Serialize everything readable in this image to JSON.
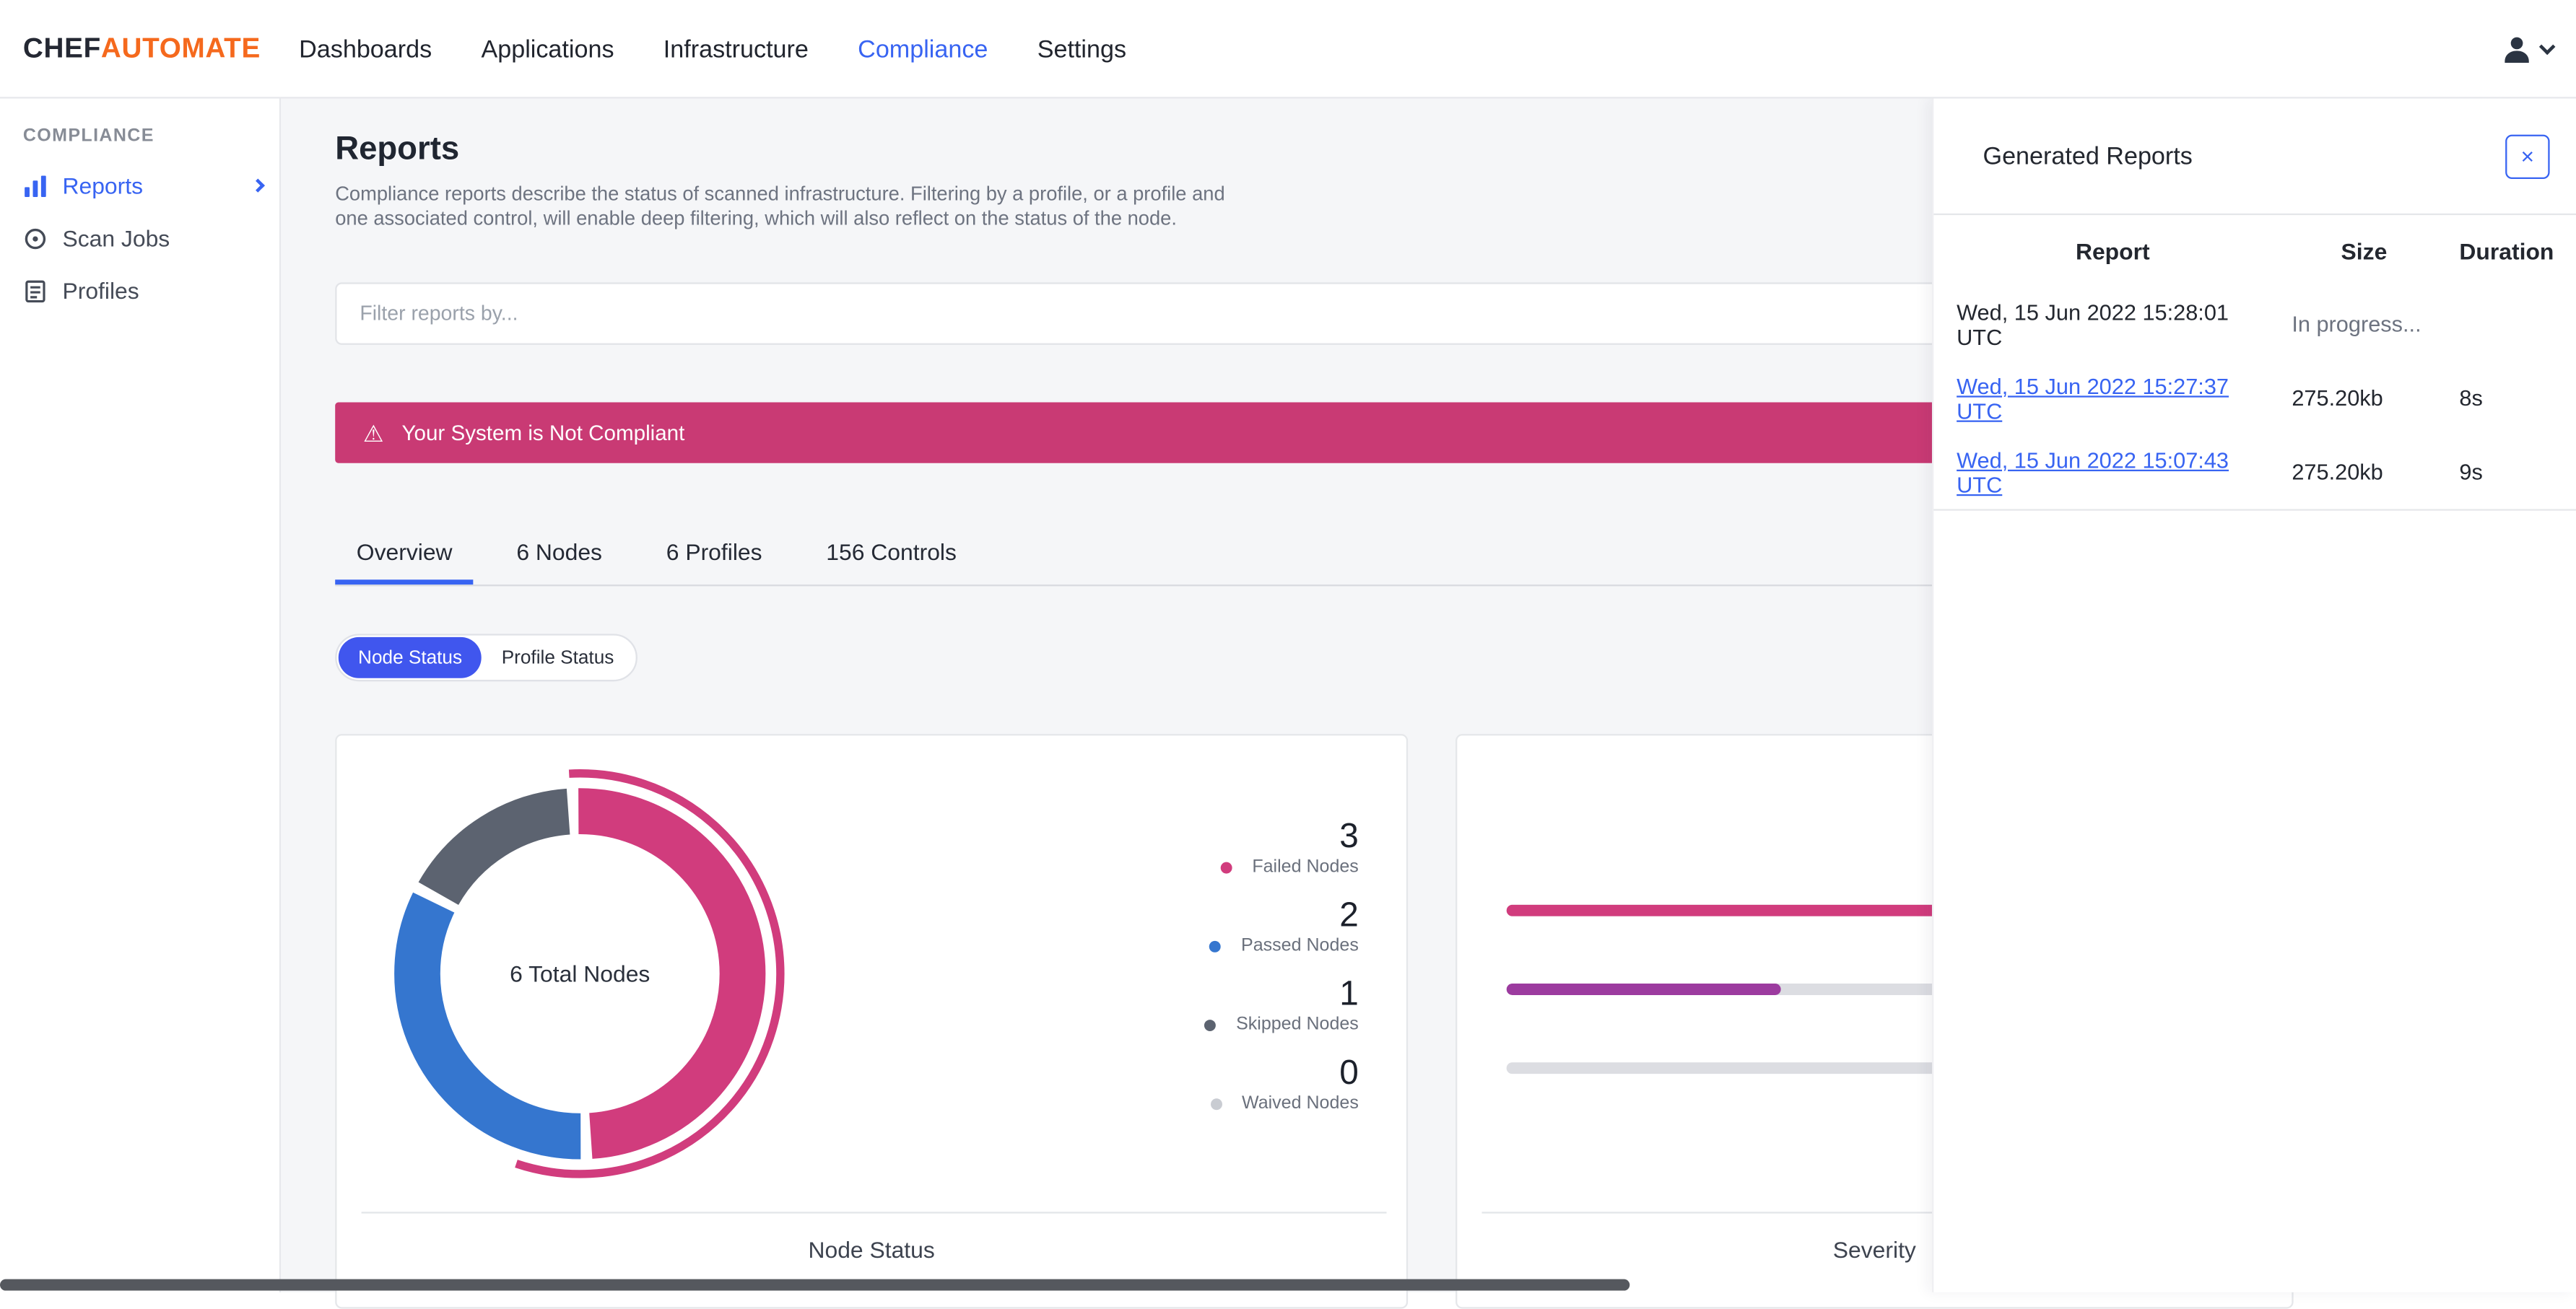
{
  "navbar": {
    "logo_chef": "CHEF",
    "logo_automate": "AUTOMATE",
    "items": [
      {
        "label": "Dashboards"
      },
      {
        "label": "Applications"
      },
      {
        "label": "Infrastructure"
      },
      {
        "label": "Compliance"
      },
      {
        "label": "Settings"
      }
    ]
  },
  "sidebar": {
    "section": "COMPLIANCE",
    "items": [
      {
        "label": "Reports"
      },
      {
        "label": "Scan Jobs"
      },
      {
        "label": "Profiles"
      }
    ]
  },
  "page": {
    "title": "Reports",
    "description_line1": "Compliance reports describe the status of scanned infrastructure. Filtering by a profile, or a profile and",
    "description_line2": "one associated control, will enable deep filtering, which will also reflect on the status of the node.",
    "filter_placeholder": "Filter reports by...",
    "alert_text": "Your System is Not Compliant"
  },
  "icons": {
    "warning": "⚠",
    "close": "×"
  },
  "tabs": [
    {
      "label": "Overview"
    },
    {
      "label": "6 Nodes"
    },
    {
      "label": "6 Profiles"
    },
    {
      "label": "156 Controls"
    }
  ],
  "status_toggle": [
    {
      "label": "Node Status"
    },
    {
      "label": "Profile Status"
    }
  ],
  "panel": {
    "title": "Generated Reports",
    "columns": [
      "Report",
      "Size",
      "Duration"
    ],
    "rows": [
      {
        "report": "Wed, 15 Jun 2022 15:28:01 UTC",
        "size": "In progress...",
        "duration": ""
      },
      {
        "report": "Wed, 15 Jun 2022 15:27:37 UTC",
        "size": "275.20kb",
        "duration": "8s"
      },
      {
        "report": "Wed, 15 Jun 2022 15:07:43 UTC",
        "size": "275.20kb",
        "duration": "9s"
      }
    ]
  },
  "chart_data": [
    {
      "type": "pie",
      "subtype": "donut",
      "title": "Node Status",
      "center_label": "6 Total Nodes",
      "labels": [
        "Failed Nodes",
        "Passed Nodes",
        "Skipped Nodes",
        "Waived Nodes"
      ],
      "values": [
        3,
        2,
        1,
        0
      ],
      "colors": [
        "#D13C7D",
        "#3576CF",
        "#5C6370",
        "#C9CCD2"
      ],
      "selected": "Failed Nodes",
      "legend_position": "right"
    },
    {
      "type": "bar",
      "title": "Severity",
      "orientation": "horizontal",
      "track_color": "#DCDDE2",
      "series": [
        {
          "fill_fraction": 1.0,
          "color": "#D13C7D"
        },
        {
          "fill_fraction": 0.37,
          "color": "#9C3B9F"
        },
        {
          "fill_fraction": 0.0,
          "color": "#DCDDE2"
        }
      ]
    }
  ]
}
